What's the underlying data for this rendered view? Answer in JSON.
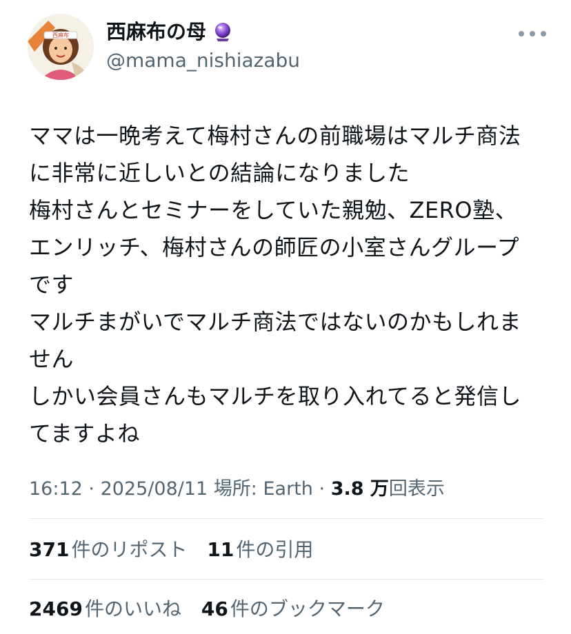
{
  "user": {
    "display_name": "西麻布の母",
    "badge_icon": "crystal-ball-icon",
    "handle": "@mama_nishiazabu",
    "avatar_headband_text": "西麻布"
  },
  "tweet": {
    "lines": [
      "ママは一晩考えて梅村さんの前職場はマルチ商法",
      "に非常に近しいとの結論になりました",
      "梅村さんとセミナーをしていた親勉、ZERO塾、",
      "エンリッチ、梅村さんの師匠の小室さんグループ",
      "です",
      "マルチまがいでマルチ商法ではないのかもしれま",
      "せん",
      "しかい会員さんもマルチを取り入れてると発信し",
      "てますよね"
    ]
  },
  "meta": {
    "time": "16:12",
    "separator": "·",
    "date": "2025/08/11",
    "location": "場所: Earth",
    "views_number": "3.8 万",
    "views_label": "回表示"
  },
  "stats": {
    "reposts_count": "371",
    "reposts_label": "件のリポスト",
    "quotes_count": "11",
    "quotes_label": "件の引用",
    "likes_count": "2469",
    "likes_label": "件のいいね",
    "bookmarks_count": "46",
    "bookmarks_label": "件のブックマーク"
  },
  "colors": {
    "text": "#0f1419",
    "secondary": "#536471",
    "divider": "#e6e9ec",
    "badge_purple": "#7b3fc4"
  }
}
